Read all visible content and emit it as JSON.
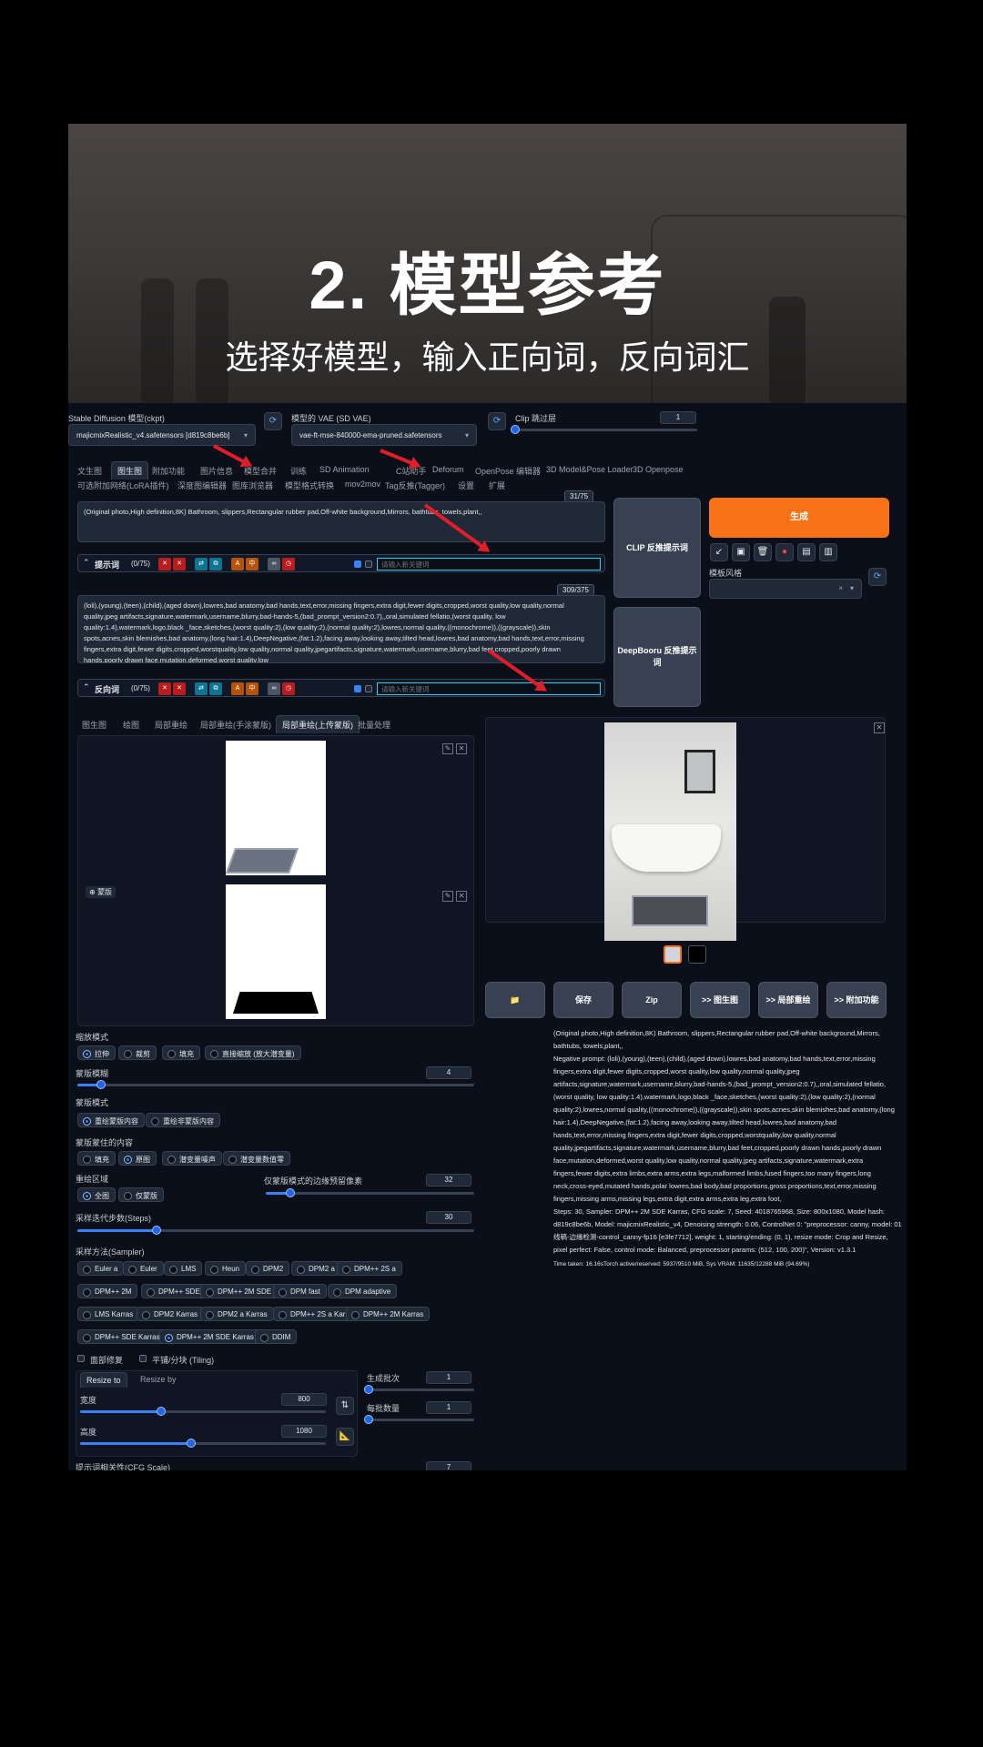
{
  "banner": {
    "title": "2. 模型参考",
    "subtitle": "选择好模型，输入正向词，反向词汇"
  },
  "top": {
    "ckpt_label": "Stable Diffusion 模型(ckpt)",
    "ckpt_value": "majicmixRealistic_v4.safetensors [d819c8be6b]",
    "vae_label": "模型的 VAE (SD VAE)",
    "vae_value": "vae-ft-mse-840000-ema-pruned.safetensors",
    "clip_label": "Clip 跳过层",
    "clip_value": "1",
    "clip_fraction": 0.0
  },
  "tabs_row1": [
    "文生图",
    "图生图",
    "附加功能",
    "图片信息",
    "模型合并",
    "训练",
    "SD Animation",
    "C站助手",
    "Deforum",
    "OpenPose 编辑器",
    "3D Model&Pose Loader",
    "3D Openpose"
  ],
  "tabs_row2": [
    "可选附加网络(LoRA插件)",
    "深度图编辑器",
    "图库浏览器",
    "模型格式转换",
    "mov2mov",
    "Tag反推(Tagger)",
    "设置",
    "扩展"
  ],
  "prompt": {
    "text": "(Original photo,High definition,8K)   Bathroom, slippers,Rectangular rubber pad,Off-white background,Mirrors, bathtubs, towels,plant,,",
    "counter": "31/75",
    "bar_label": "提示词",
    "bar_count": "(0/75)",
    "keyword_placeholder": "请输入新关键词"
  },
  "negative": {
    "text": "(loli),(young),(teen),(child),(aged down),lowres,bad anatomy,bad hands,text,error,missing fingers,extra digit,fewer digits,cropped,worst quality,low quality,normal quality,jpeg artifacts,signature,watermark,username,blurry,bad-hands-5,(bad_prompt_version2:0.7),,oral,simulated fellatio,(worst quality, low quality:1.4),watermark,logo,black _face,sketches,(worst quality:2),(low quality:2),(normal quality:2),lowres,normal quality,((monochrome)),((grayscale)),skin spots,acnes,skin blemishes,bad anatomy,(long hair:1.4),DeepNegative,(fat:1.2),facing away,looking away,tilted head,lowres,bad anatomy,bad hands,text,error,missing fingers,extra digit,fewer digits,cropped,worstquality,low quality,normal quality,jpegartifacts,signature,watermark,username,blurry,bad feet,cropped,poorly drawn hands,poorly drawn face,mutation,deformed,worst quality,low",
    "counter": "309/375",
    "bar_label": "反向词",
    "bar_count": "(0/75)",
    "keyword_placeholder": "请输入新关键词"
  },
  "right": {
    "clip_btn": "CLIP 反推提示词",
    "deepbooru_btn": "DeepBooru 反推提示词",
    "generate": "生成",
    "style_label": "模板风格",
    "style_clear": "×"
  },
  "img_tabs": [
    "图生图",
    "绘图",
    "局部重绘",
    "局部重绘(手涂蒙版)",
    "局部重绘(上传蒙版)",
    "批量处理"
  ],
  "mask_label": "蒙版",
  "resize_mode": {
    "label": "缩放模式",
    "options": [
      "拉伸",
      "裁剪",
      "填充",
      "直接缩放 (放大潜变量)"
    ],
    "selected": "拉伸"
  },
  "mask_blur": {
    "label": "蒙版模糊",
    "value": "4",
    "fraction": 0.06
  },
  "mask_mode": {
    "label": "蒙版模式",
    "options": [
      "重绘蒙版内容",
      "重绘非蒙版内容"
    ],
    "selected": "重绘蒙版内容"
  },
  "masked_content": {
    "label": "蒙版蒙住的内容",
    "options": [
      "填充",
      "原图",
      "潜变量噪声",
      "潜变量数值零"
    ],
    "selected": "原图"
  },
  "inpaint_area": {
    "label": "重绘区域",
    "options": [
      "全图",
      "仅蒙版"
    ],
    "selected": "全图"
  },
  "padding": {
    "label": "仅蒙版模式的边缘预留像素",
    "value": "32",
    "fraction": 0.12
  },
  "steps": {
    "label": "采样迭代步数(Steps)",
    "value": "30",
    "fraction": 0.2
  },
  "sampler": {
    "label": "采样方法(Sampler)",
    "options": [
      "Euler a",
      "Euler",
      "LMS",
      "Heun",
      "DPM2",
      "DPM2 a",
      "DPM++ 2S a",
      "DPM++ 2M",
      "DPM++ SDE",
      "DPM++ 2M SDE",
      "DPM fast",
      "DPM adaptive",
      "LMS Karras",
      "DPM2 Karras",
      "DPM2 a Karras",
      "DPM++ 2S a Karras",
      "DPM++ 2M Karras",
      "DPM++ SDE Karras",
      "DPM++ 2M SDE Karras",
      "DDIM"
    ],
    "selected": "DPM++ 2M SDE Karras"
  },
  "restore_faces": "面部修复",
  "tiling": "平铺/分块 (Tiling)",
  "resize_tabs": [
    "Resize to",
    "Resize by"
  ],
  "width": {
    "label": "宽度",
    "value": "800",
    "fraction": 0.33
  },
  "height": {
    "label": "高度",
    "value": "1080",
    "fraction": 0.45
  },
  "batch_count": {
    "label": "生成批次",
    "value": "1",
    "fraction": 0.0
  },
  "batch_size": {
    "label": "每批数量",
    "value": "1",
    "fraction": 0.0
  },
  "cfg": {
    "label": "提示词相关性(CFG Scale)",
    "value": "7"
  },
  "output_buttons": [
    "📁",
    "保存",
    "Zip",
    ">> 图生图",
    ">> 局部重绘",
    ">> 附加功能"
  ],
  "info": {
    "prompt": "(Original photo,High definition,8K)   Bathroom, slippers,Rectangular rubber pad,Off-white background,Mirrors, bathtubs, towels,plant,,",
    "negative": "Negative prompt: (loli),(young),(teen),(child),(aged down),lowres,bad anatomy,bad hands,text,error,missing fingers,extra digit,fewer digits,cropped,worst quality,low quality,normal quality,jpeg artifacts,signature,watermark,username,blurry,bad-hands-5,(bad_prompt_version2:0.7),,oral,simulated fellatio,(worst quality, low quality:1.4),watermark,logo,black _face,sketches,(worst quality:2),(low quality:2),(normal quality:2),lowres,normal quality,((monochrome)),((grayscale)),skin spots,acnes,skin blemishes,bad anatomy,(long hair:1.4),DeepNegative,(fat:1.2),facing away,looking away,tilted head,lowres,bad anatomy,bad hands,text,error,missing fingers,extra digit,fewer digits,cropped,worstquality,low quality,normal quality,jpegartifacts,signature,watermark,username,blurry,bad feet,cropped,poorly drawn hands,poorly drawn face,mutation,deformed,worst quality,low quality,normal quality,jpeg artifacts,signature,watermark,extra fingers,fewer digits,extra limbs,extra arms,extra legs,malformed limbs,fused fingers,too many fingers,long neck,cross-eyed,mutated hands,polar lowres,bad body,bad proportions,gross proportions,text,error,missing fingers,missing arms,missing legs,extra digit,extra arms,extra leg,extra foot,",
    "params": "Steps: 30, Sampler: DPM++ 2M SDE Karras, CFG scale: 7, Seed: 4018765968, Size: 800x1080, Model hash: d819c8be6b, Model: majicmixRealistic_v4, Denoising strength: 0.06, ControlNet 0: \"preprocessor: canny, model: 01线稿-边缘检测-control_canny-fp16 [e3fe7712], weight: 1, starting/ending: (0, 1), resize mode: Crop and Resize, pixel perfect: False, control mode: Balanced, preprocessor params: (512, 100, 200)\", Version: v1.3.1",
    "time": "Time taken: 16.16sTorch active/reserved: 5937/9510 MiB, Sys VRAM: 11635/12288 MiB (94.69%)"
  },
  "colors": {
    "accent": "#f97316",
    "slider": "#3b82f6",
    "bg": "#0b0f19",
    "arrow": "#e11d2a"
  }
}
